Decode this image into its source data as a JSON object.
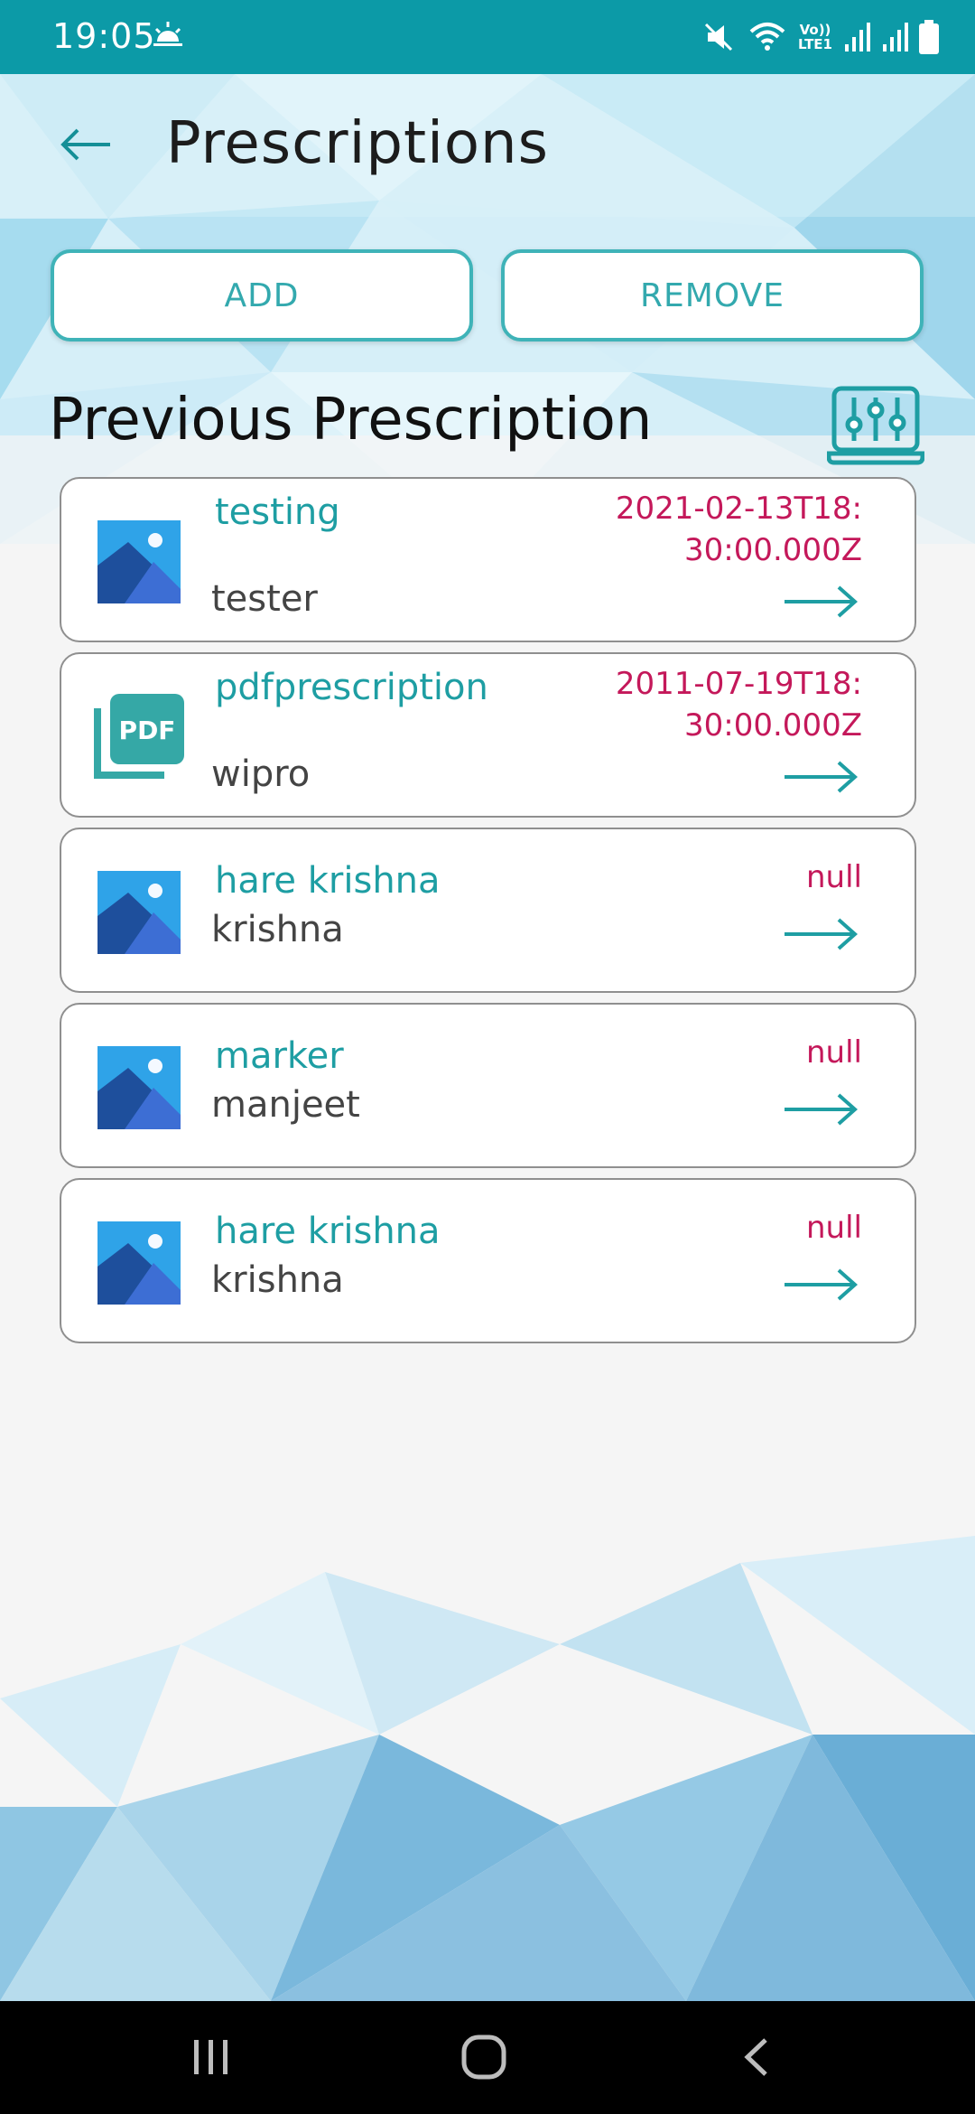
{
  "status_bar": {
    "time": "19:05",
    "volte_line1": "Vo))",
    "volte_line2": "LTE1",
    "icons": [
      "weather-sunrise-icon",
      "mute-icon",
      "wifi-icon",
      "volte-icon",
      "signal-icon",
      "signal-icon",
      "battery-icon"
    ]
  },
  "header": {
    "back_icon": "arrow-left-icon",
    "title": "Prescriptions"
  },
  "actions": {
    "add_label": "ADD",
    "remove_label": "REMOVE"
  },
  "section": {
    "title": "Previous Prescription",
    "filter_icon": "sliders-icon"
  },
  "prescriptions": [
    {
      "title": "testing",
      "subtitle": "tester",
      "date_line1": "2021-02-13T18:",
      "date_line2": "30:00.000Z",
      "thumb": "image-icon"
    },
    {
      "title": "pdfprescription",
      "subtitle": "wipro",
      "date_line1": "2011-07-19T18:",
      "date_line2": "30:00.000Z",
      "thumb": "pdf-icon"
    },
    {
      "title": "hare krishna",
      "subtitle": "krishna",
      "date_line1": "null",
      "date_line2": "",
      "thumb": "image-icon"
    },
    {
      "title": "marker",
      "subtitle": "manjeet",
      "date_line1": "null",
      "date_line2": "",
      "thumb": "image-icon"
    },
    {
      "title": "hare krishna",
      "subtitle": "krishna",
      "date_line1": "null",
      "date_line2": "",
      "thumb": "image-icon"
    }
  ],
  "colors": {
    "status_bar": "#0c9aa7",
    "accent": "#1e9ea3",
    "date": "#c4185a",
    "button_border": "#3fb3b8"
  },
  "navigation": {
    "icons": [
      "recent-apps-icon",
      "home-icon",
      "back-icon"
    ]
  }
}
